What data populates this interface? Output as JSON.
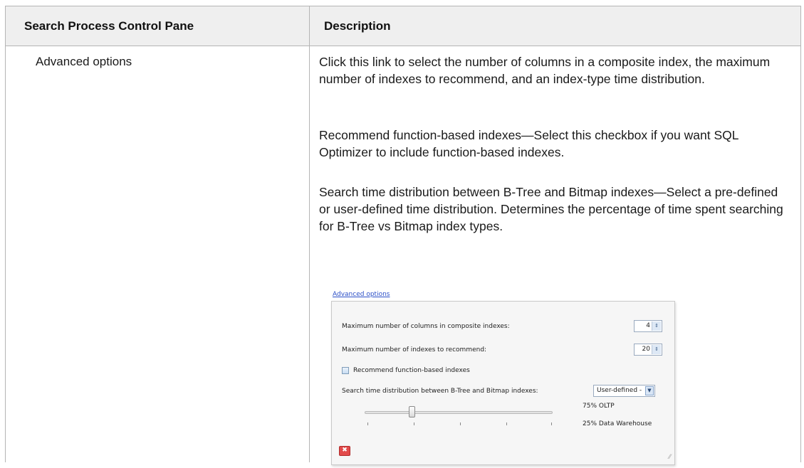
{
  "table": {
    "headers": [
      "Search Process Control Pane",
      "Description"
    ],
    "row": {
      "name": "Advanced options",
      "paragraphs": [
        "Click this link to select the number of columns in a composite index, the maximum number of indexes to recommend, and an index-type time distribution.",
        "Recommend function-based indexes—Select this checkbox if you want SQL Optimizer to include function-based indexes.",
        "Search time distribution between B-Tree and Bitmap indexes—Select a pre-defined or user-defined time distribution. Determines the percentage of time spent searching for B-Tree vs Bitmap index types."
      ]
    }
  },
  "dialog": {
    "link": "Advanced options",
    "max_columns_label": "Maximum number of columns in composite indexes:",
    "max_columns_value": "4",
    "max_indexes_label": "Maximum number of indexes to recommend:",
    "max_indexes_value": "20",
    "function_based_label": "Recommend function-based indexes",
    "function_based_checked": false,
    "distribution_label": "Search time distribution between B-Tree and Bitmap indexes:",
    "distribution_value": "User-defined -",
    "slider_value_fraction": 0.25,
    "oltp_label": "75% OLTP",
    "dw_label": "25% Data Warehouse"
  },
  "colors": {
    "header_bg": "#efefef",
    "link": "#2b4fc7",
    "close": "#e24b4b"
  },
  "icons": [
    "spin-up-down-icon",
    "dropdown-arrow-icon",
    "close-icon",
    "resize-grip-icon"
  ]
}
